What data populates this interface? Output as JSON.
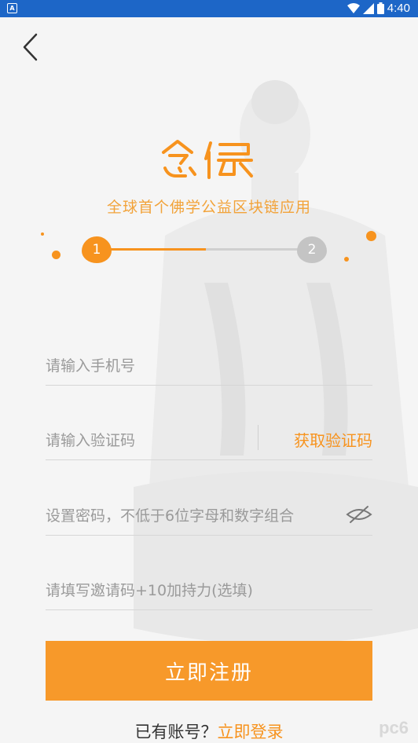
{
  "status_bar": {
    "time": "4:40"
  },
  "brand": {
    "slogan": "全球首个佛学公益区块链应用"
  },
  "steps": {
    "step1": "1",
    "step2": "2"
  },
  "form": {
    "phone_placeholder": "请输入手机号",
    "code_placeholder": "请输入验证码",
    "get_code_label": "获取验证码",
    "password_placeholder": "设置密码，不低于6位字母和数字组合",
    "invite_placeholder": "请填写邀请码+10加持力(选填)",
    "submit_label": "立即注册"
  },
  "footer": {
    "have_account": "已有账号？",
    "login_link": "立即登录"
  },
  "colors": {
    "accent": "#f7931e",
    "status_bar": "#1d66c7"
  }
}
